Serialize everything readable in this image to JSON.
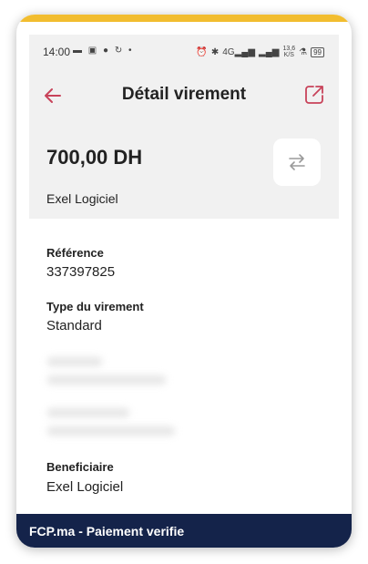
{
  "colors": {
    "accent": "#f2bd2f",
    "grey_zone": "#f1f1f1",
    "brand": "#c8435a",
    "footer_bg": "#14234a"
  },
  "status_bar": {
    "time": "14:00",
    "left_icons": [
      "message-icon",
      "image-icon",
      "facebook-icon",
      "refresh-icon",
      "dot"
    ],
    "right_icons": [
      "alarm-icon",
      "bluetooth-icon",
      "signal-4g-icon",
      "signal-icon",
      "speed-icon",
      "lab-icon",
      "battery-icon"
    ],
    "network": "4G",
    "speed": "13,6",
    "speed_unit": "K/S",
    "battery": "99"
  },
  "header": {
    "title": "Détail virement",
    "back_icon": "arrow-left-icon",
    "share_icon": "share-external-icon"
  },
  "summary": {
    "amount": "700,00 DH",
    "account_name": "Exel Logiciel",
    "transfer_icon": "transfer-arrows-icon"
  },
  "details": {
    "reference_label": "Référence",
    "reference_value": "337397825",
    "type_label": "Type du virement",
    "type_value": "Standard",
    "beneficiary_label": "Beneficiaire",
    "beneficiary_value": "Exel Logiciel"
  },
  "footer": {
    "text": "FCP.ma - Paiement verifie"
  }
}
